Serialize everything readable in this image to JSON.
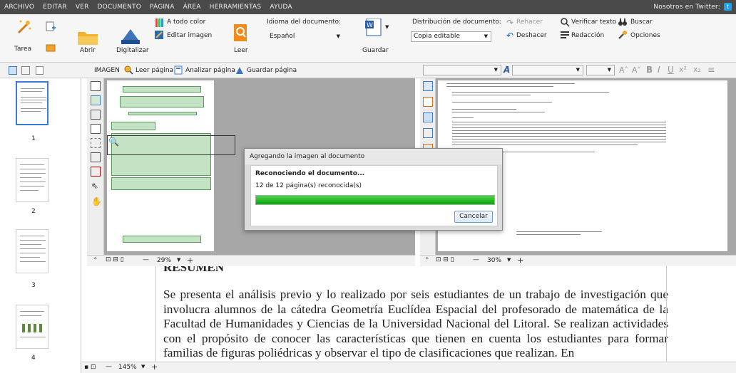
{
  "menu": [
    "ARCHIVO",
    "EDITAR",
    "VER",
    "DOCUMENTO",
    "PÁGINA",
    "ÁREA",
    "HERRAMIENTAS",
    "AYUDA"
  ],
  "twitter": "Nosotros en Twitter:",
  "ribbon": {
    "tarea": "Tarea",
    "abrir": "Abrir",
    "digitalizar": "Digitalizar",
    "a_todo_color": "A todo color",
    "editar_imagen": "Editar imagen",
    "leer": "Leer",
    "idioma_label": "Idioma del documento:",
    "idioma_value": "Español",
    "guardar": "Guardar",
    "distribucion_label": "Distribución de documento:",
    "distribucion_value": "Copia editable",
    "rehacer": "Rehacer",
    "deshacer": "Deshacer",
    "verificar_texto": "Verificar texto",
    "redaccion": "Redacción",
    "buscar": "Buscar",
    "opciones": "Opciones"
  },
  "toolbar2": {
    "imagen": "IMAGEN",
    "leer_pagina": "Leer página",
    "analizar_pagina": "Analizar página",
    "guardar_pagina": "Guardar página"
  },
  "thumbs": [
    "1",
    "2",
    "3",
    "4"
  ],
  "zoom_image": "29%",
  "zoom_text": "30%",
  "zoom_doc": "145%",
  "dialog": {
    "title": "Agregando la imagen al documento",
    "status": "Reconociendo el documento...",
    "progress_text": "12 de 12 página(s) reconocida(s)",
    "progress": 1.0,
    "cancel": "Cancelar"
  },
  "doc": {
    "heading": "RESUMEN",
    "body": "Se presenta el análisis previo y lo realizado por seis estudiantes de un trabajo de investigación que involucra alumnos de la cátedra Geometría Euclídea Espacial del profesorado de matemática de la Facultad de Humanidades y Ciencias de la Universidad Nacional del Litoral. Se realizan actividades con el propósito de conocer las características que tienen en cuenta los estudiantes para formar  familias de figuras poliédricas y observar el tipo de clasificaciones que realizan. En"
  },
  "colors": {
    "accent": "#3a7bd5",
    "progress": "#15b015",
    "menubar": "#4a4a4a"
  }
}
